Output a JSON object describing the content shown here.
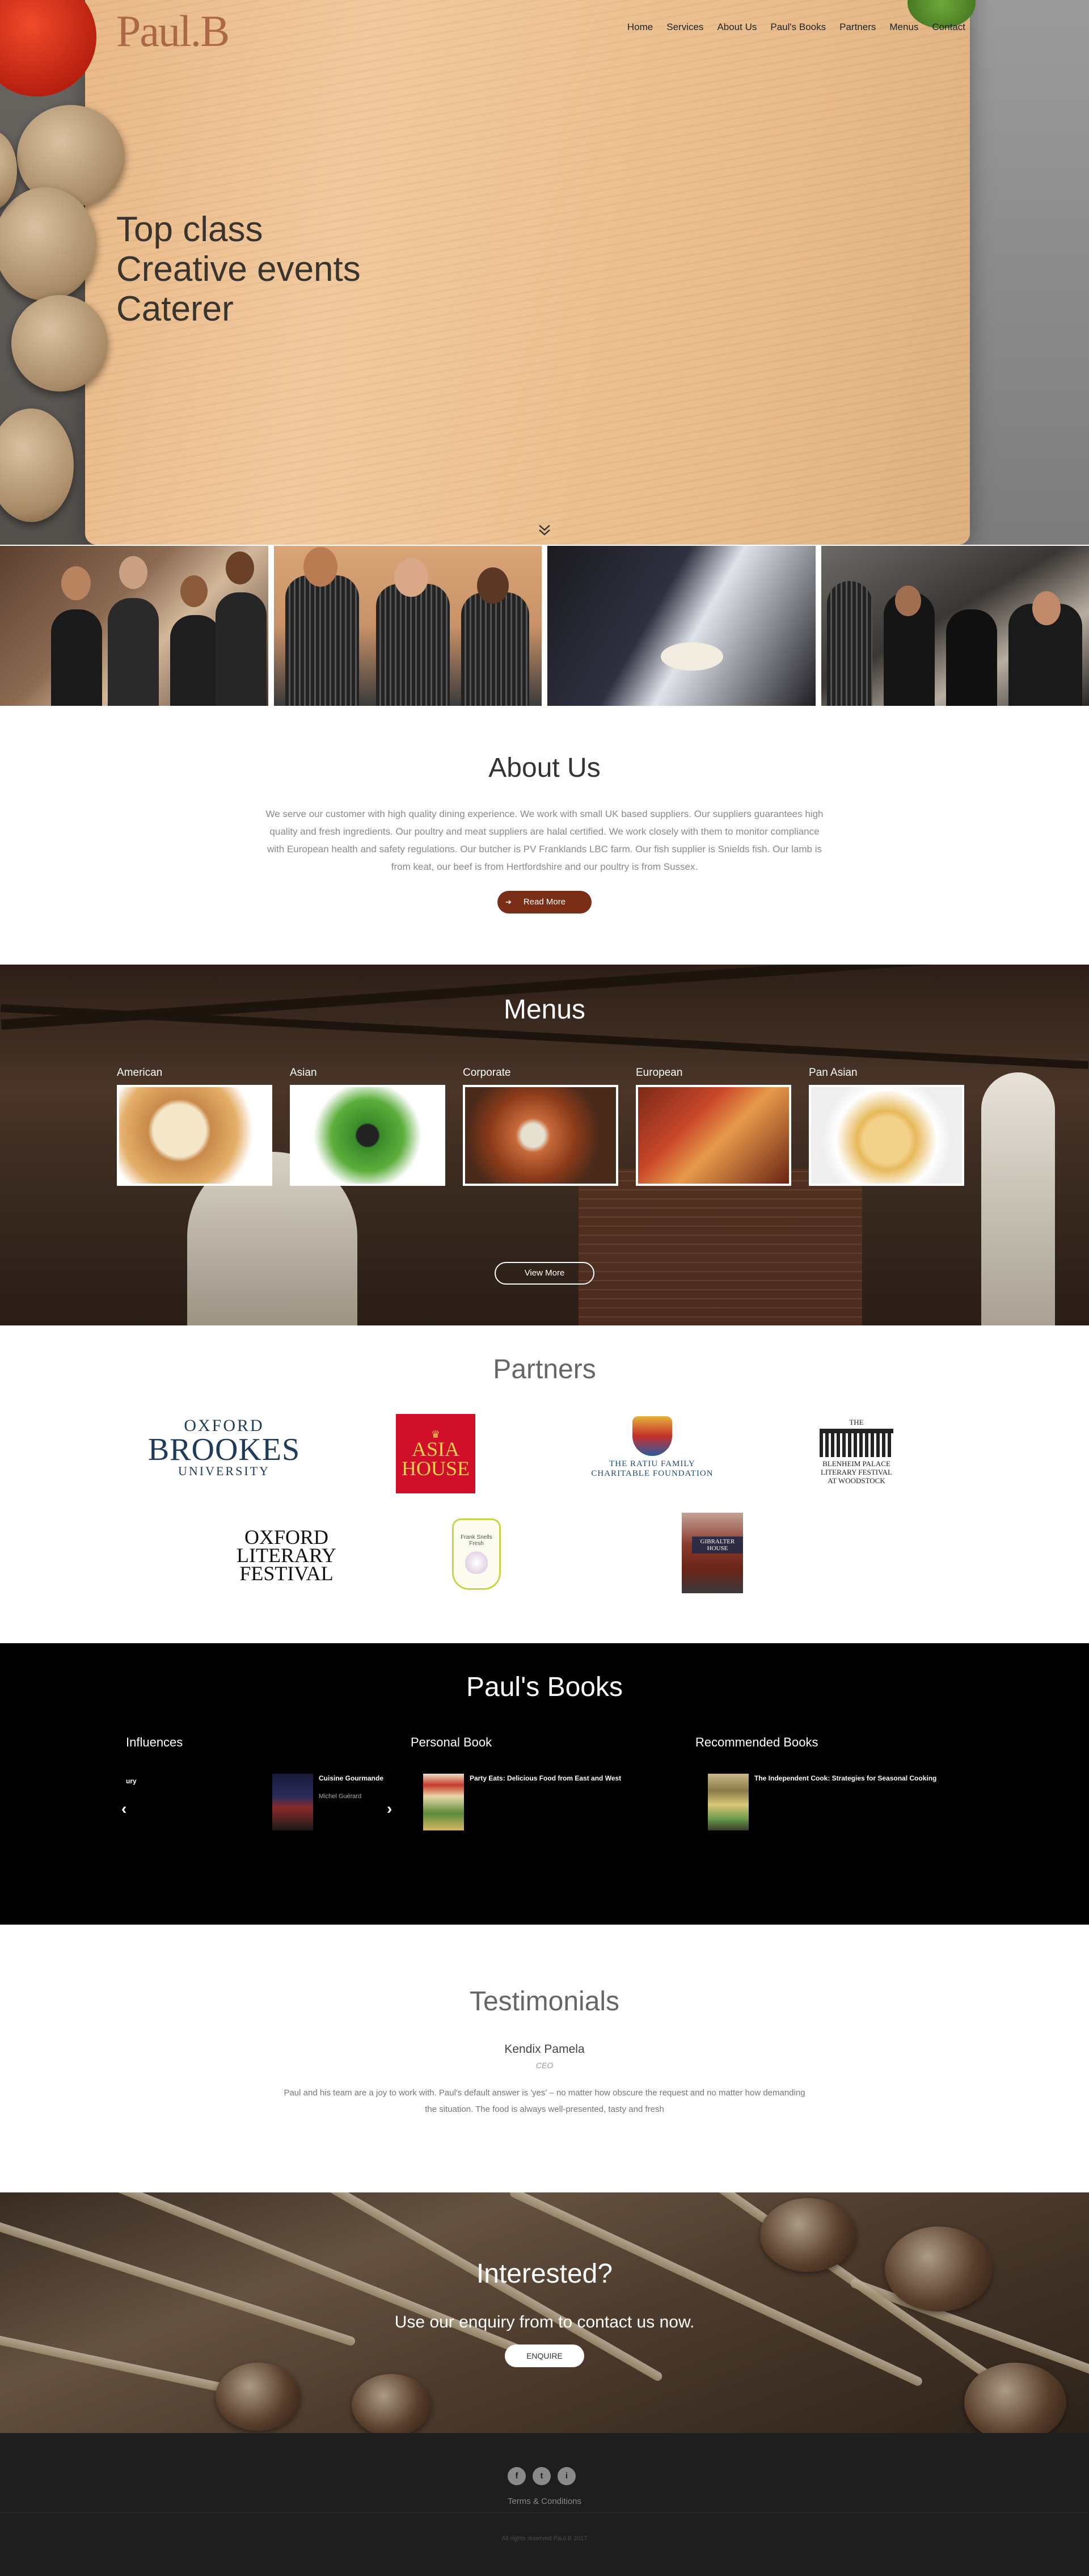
{
  "header": {
    "logo": "Paul.B",
    "nav": [
      "Home",
      "Services",
      "About Us",
      "Paul's Books",
      "Partners",
      "Menus",
      "Contact"
    ]
  },
  "hero": {
    "tagline": [
      "Top class",
      "Creative events",
      "Caterer"
    ],
    "scroll_icon": "double-chevron-down-icon"
  },
  "about": {
    "title": "About Us",
    "text": "We serve our customer with high quality dining experience. We work with small UK based suppliers. Our suppliers guarantees high quality and fresh ingredients. Our poultry and meat suppliers are halal certified. We work closely with them to monitor compliance with European health and safety regulations. Our butcher is PV Franklands LBC farm. Our fish supplier is Snields fish. Our lamb is from keat, our beef is from Hertfordshire and our poultry is from Sussex.",
    "button": "Read More"
  },
  "menus": {
    "title": "Menus",
    "items": [
      "American",
      "Asian",
      "Corporate",
      "European",
      "Pan Asian"
    ],
    "button": "View More"
  },
  "partners": {
    "title": "Partners",
    "brookes": [
      "OXFORD",
      "BROOKES",
      "UNIVERSITY"
    ],
    "asia": [
      "ASIA",
      "HOUSE"
    ],
    "ratiu": [
      "THE RATIU FAMILY",
      "CHARITABLE FOUNDATION"
    ],
    "blenheim": [
      "THE",
      "BLENHEIM PALACE",
      "LITERARY FESTIVAL",
      "AT WOODSTOCK"
    ],
    "olf": [
      "OXFORD",
      "LITERARY",
      "FESTIVAL"
    ],
    "frank": "Frank Snells Fresh",
    "gib": "GIBRALTER HOUSE"
  },
  "books": {
    "title": "Paul's Books",
    "columns": [
      "Influences",
      "Personal Book",
      "Recommended Books"
    ],
    "fragment": "ury",
    "influence": {
      "title": "Cuisine Gourmande",
      "author": "Michel Guérard"
    },
    "personal": {
      "title": "Party Eats: Delicious Food from East and West"
    },
    "recommended": {
      "title": "The Independent Cook: Strategies for Seasonal Cooking"
    }
  },
  "testimonials": {
    "title": "Testimonials",
    "name": "Kendix Pamela",
    "role": "CEO",
    "quote": "Paul and his team are a joy to work with. Paul's default answer is 'yes' – no matter how obscure the request and no matter how demanding the situation. The food is always well-presented, tasty and fresh"
  },
  "cta": {
    "title": "Interested?",
    "subtitle": "Use our enquiry from to contact us now.",
    "button": "ENQUIRE"
  },
  "footer": {
    "social": [
      "f",
      "t",
      "i"
    ],
    "terms": "Terms & Conditions",
    "copyright": "All rights reserved Paul.B 2017"
  },
  "colors": {
    "accent": "#7a2e17",
    "dark": "#1e1e1e"
  }
}
